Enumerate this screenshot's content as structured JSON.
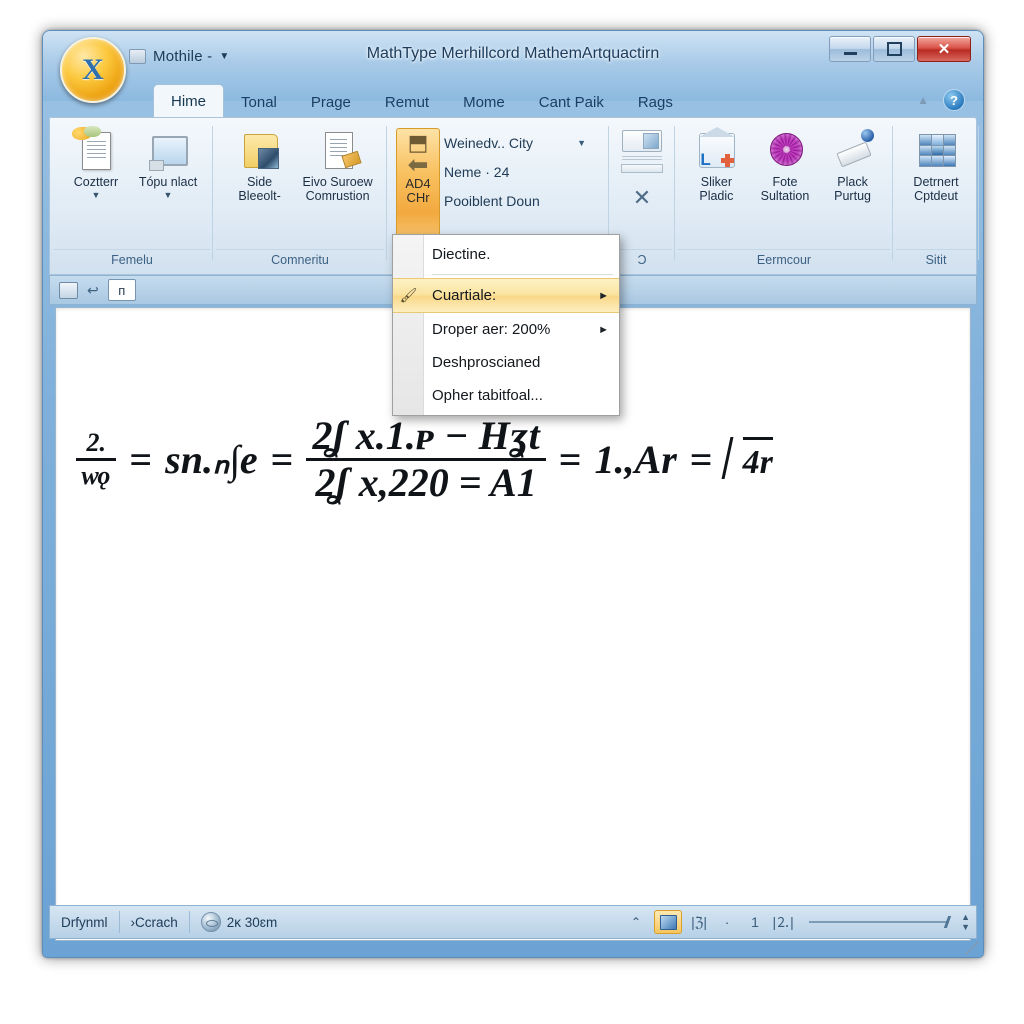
{
  "window": {
    "title": "MathType Merhillcord MathemArtquactirn",
    "quick_access": {
      "doc_label": "Mothile -",
      "caret": "▼"
    },
    "orb_glyph": "X",
    "controls": {
      "minimize": "minimize-icon",
      "maximize": "maximize-icon",
      "close": "✕"
    }
  },
  "tabs": [
    {
      "label": "Hime",
      "active": true
    },
    {
      "label": "Tonal",
      "active": false
    },
    {
      "label": "Prage",
      "active": false
    },
    {
      "label": "Remut",
      "active": false
    },
    {
      "label": "Mome",
      "active": false
    },
    {
      "label": "Cant Paik",
      "active": false
    },
    {
      "label": "Rags",
      "active": false
    }
  ],
  "tabrow_right": {
    "collapse": "▲",
    "help": "?"
  },
  "ribbon": {
    "groups": [
      {
        "name": "Femelu",
        "buttons": [
          {
            "label_1": "Coztterr",
            "label_2": "",
            "dropdown": "▼",
            "icon": "document-note-icon"
          },
          {
            "label_1": "Tópu nlact",
            "label_2": "",
            "dropdown": "▼",
            "icon": "screen-icon"
          }
        ]
      },
      {
        "name": "Comneritu",
        "buttons": [
          {
            "label_1": "Side",
            "label_2": "Bleeolt-",
            "dropdown": "",
            "icon": "folder-image-icon"
          },
          {
            "label_1": "Eivo Suroew",
            "label_2": "Comrustion",
            "dropdown": "",
            "icon": "page-pen-icon"
          }
        ]
      },
      {
        "name": "",
        "hot_button": {
          "top_arrow": "⬒",
          "back_arrow": "⬅",
          "line1": "AD4",
          "line2": "CHr"
        },
        "combos": [
          {
            "value": "Weinedv.. City",
            "caret": "▼"
          },
          {
            "value": "Neme · 24",
            "caret": ""
          },
          {
            "value": "Pooiblent Doun",
            "caret": ""
          }
        ]
      },
      {
        "name": "Ɔ",
        "small_stack": {
          "thumb": "preview-thumbnail-icon",
          "x": "✕"
        }
      },
      {
        "name": "Eermcour",
        "buttons": [
          {
            "label_1": "Sliker",
            "label_2": "Pladic",
            "dropdown": "",
            "icon": "house-add-icon"
          },
          {
            "label_1": "Fote",
            "label_2": "Sultation",
            "dropdown": "",
            "icon": "flower-wheel-icon"
          },
          {
            "label_1": "Plack",
            "label_2": "Purtug",
            "dropdown": "",
            "icon": "pen-marker-icon"
          }
        ]
      },
      {
        "name": "Sitit",
        "buttons": [
          {
            "label_1": "Detrnert",
            "label_2": "Cptdeut",
            "dropdown": "",
            "icon": "grid-layout-icon"
          }
        ]
      }
    ]
  },
  "toolbar_strip": {
    "icon_1": "stamp-icon",
    "icon_2": "↩",
    "box_label": "ᴨ"
  },
  "context_menu": {
    "items": [
      {
        "label": "Diectine.",
        "selected": false,
        "submenu": false,
        "icon": "",
        "underline": ""
      },
      {
        "label": "Cuartiale:",
        "selected": true,
        "submenu": true,
        "icon": "brush-icon",
        "underline": ""
      },
      {
        "label": "Droper aer: 200%",
        "selected": false,
        "submenu": true,
        "icon": "",
        "underline": ""
      },
      {
        "label": "Deshproscianed",
        "selected": false,
        "submenu": false,
        "icon": "",
        "underline": "D"
      },
      {
        "label": "Opher tabitfoal...",
        "selected": false,
        "submenu": false,
        "icon": "",
        "underline": ""
      }
    ],
    "submenu_arrow": "►"
  },
  "document": {
    "equation": {
      "term_1_num": "2.",
      "term_1_den": "ᴡǫ",
      "eq_1": "=",
      "term_2": "sn.ₙ∫e",
      "eq_2": "=",
      "frac_num": "2ʆ x.1.ᴘ − Hʓt",
      "frac_den": "2ʆ x,220 = A1",
      "eq_3": "=",
      "term_3": "1.,Ar",
      "eq_4": "=",
      "sqrt_body": "4r"
    }
  },
  "status_bar": {
    "left_items": [
      "Drfynml",
      "›Ccrach"
    ],
    "page_info": "2ᴋ 30ɛm",
    "collapse_caret": "⌃",
    "view_buttons": [
      "print-layout-view",
      "full-screen-view",
      "web-layout-view",
      "outline-view"
    ],
    "view_glyphs": [
      "|ℨ|",
      "·",
      "1",
      "|⒉|"
    ],
    "zoom_slider": "zoom-slider"
  }
}
